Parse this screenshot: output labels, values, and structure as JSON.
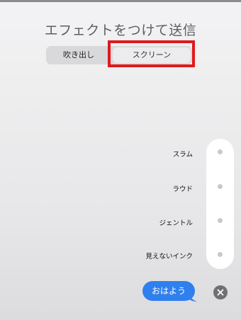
{
  "header": {
    "title": "エフェクトをつけて送信"
  },
  "tabs": [
    {
      "label": "吹き出し"
    },
    {
      "label": "スクリーン"
    }
  ],
  "effects": [
    {
      "label": "スラム"
    },
    {
      "label": "ラウド"
    },
    {
      "label": "ジェントル"
    },
    {
      "label": "見えないインク"
    }
  ],
  "message": {
    "text": "おはよう",
    "bubble_color": "#2f80ee"
  },
  "highlight": {
    "color": "#e0191d"
  },
  "icons": {
    "close": "close-icon"
  }
}
